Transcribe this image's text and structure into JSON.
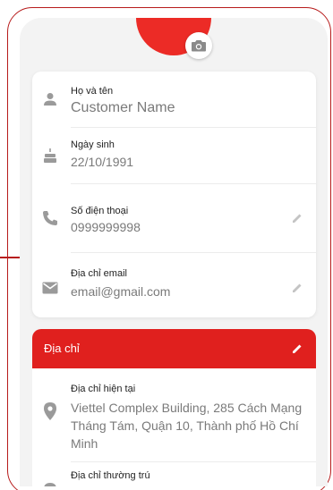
{
  "colors": {
    "accent": "#e0201e",
    "avatar": "#ec2b26",
    "frame": "#b71c1c"
  },
  "profile": {
    "camera_icon": "camera-icon",
    "fields": [
      {
        "icon": "person-icon",
        "label": "Họ và tên",
        "value": "Customer Name"
      },
      {
        "icon": "cake-icon",
        "label": "Ngày sinh",
        "value": "22/10/1991"
      },
      {
        "icon": "phone-icon",
        "label": "Số điện thoại",
        "value": "0999999998",
        "edit_icon": "pencil-icon"
      },
      {
        "icon": "mail-icon",
        "label": "Địa chỉ email",
        "value": "email@gmail.com",
        "edit_icon": "pencil-icon"
      }
    ]
  },
  "address": {
    "title": "Địa chỉ",
    "edit_icon": "pencil-icon",
    "current_label": "Địa chỉ hiện tại",
    "current_value": "Viettel Complex Building, 285 Cách Mạng Tháng Tám, Quận 10, Thành phố Hồ Chí Minh",
    "permanent_label": "Địa chỉ thường trú"
  }
}
